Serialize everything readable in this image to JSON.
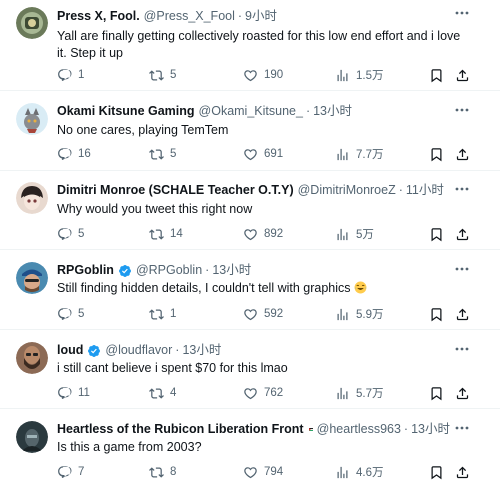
{
  "tweets": [
    {
      "name": "Press X, Fool.",
      "handle": "@Press_X_Fool",
      "dot": "·",
      "time": "9小时",
      "text": "Yall are finally getting collectively roasted for this low end effort and i love it. Step it up",
      "replies": "1",
      "retweets": "5",
      "likes": "190",
      "views": "1.5万",
      "avatar_color": "#6b7a5a"
    },
    {
      "name": "Okami Kitsune Gaming",
      "handle": "@Okami_Kitsune_",
      "dot": "·",
      "time": "13小时",
      "text": "No one cares, playing TemTem",
      "replies": "16",
      "retweets": "5",
      "likes": "691",
      "views": "7.7万",
      "avatar_color": "#d9ecf5"
    },
    {
      "name": "Dimitri Monroe (SCHALE Teacher O.T.Y)",
      "handle": "@DimitriMonroeZ",
      "dot": "·",
      "time": "11小时",
      "text": "Why would you tweet this right now",
      "replies": "5",
      "retweets": "14",
      "likes": "892",
      "views": "5万",
      "avatar_color": "#e8d9cf"
    },
    {
      "name": "RPGoblin",
      "handle": "@RPGoblin",
      "dot": "·",
      "time": "13小时",
      "text": "Still finding hidden details, I couldn't tell with graphics",
      "emoji": "laughing-emoji",
      "replies": "5",
      "retweets": "1",
      "likes": "592",
      "views": "5.9万",
      "avatar_color": "#4a8ab0"
    },
    {
      "name": "loud",
      "handle": "@loudflavor",
      "dot": "·",
      "time": "13小时",
      "text": "i still cant believe i spent $70 for this lmao",
      "replies": "11",
      "retweets": "4",
      "likes": "762",
      "views": "5.7万",
      "avatar_color": "#8c6a55"
    },
    {
      "name": "Heartless of the Rubicon Liberation Front",
      "handle": "@heartless963",
      "dot": "·",
      "time": "13小时",
      "text": "Is this a game from 2003?",
      "replies": "7",
      "retweets": "8",
      "likes": "794",
      "views": "4.6万",
      "avatar_color": "#2b3a3f"
    }
  ],
  "colors": {
    "verified": "#1d9bf0",
    "muted": "#536471",
    "text": "#0f1419",
    "divider": "#eff3f4"
  }
}
